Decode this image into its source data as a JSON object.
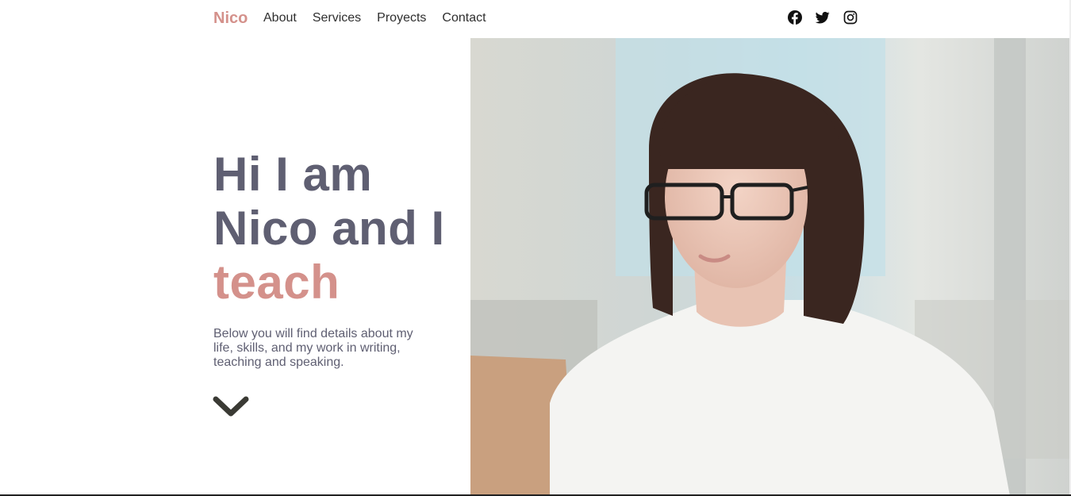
{
  "nav": {
    "brand": "Nico",
    "links": [
      "About",
      "Services",
      "Proyects",
      "Contact"
    ],
    "social": [
      {
        "icon": "facebook-icon",
        "color": "#111111"
      },
      {
        "icon": "twitter-icon",
        "color": "#111111"
      },
      {
        "icon": "instagram-icon",
        "color": "#111111"
      }
    ]
  },
  "hero": {
    "headline_line1": "Hi I am",
    "headline_line2": "Nico and I",
    "headline_accent": "teach",
    "subtext": "Below you will find details about my life, skills, and my work in writing, teaching and speaking.",
    "scroll_icon": "chevron-down-icon"
  },
  "colors": {
    "accent": "#d4918b",
    "text": "#5f5f72",
    "dark": "#2f2f2f"
  }
}
